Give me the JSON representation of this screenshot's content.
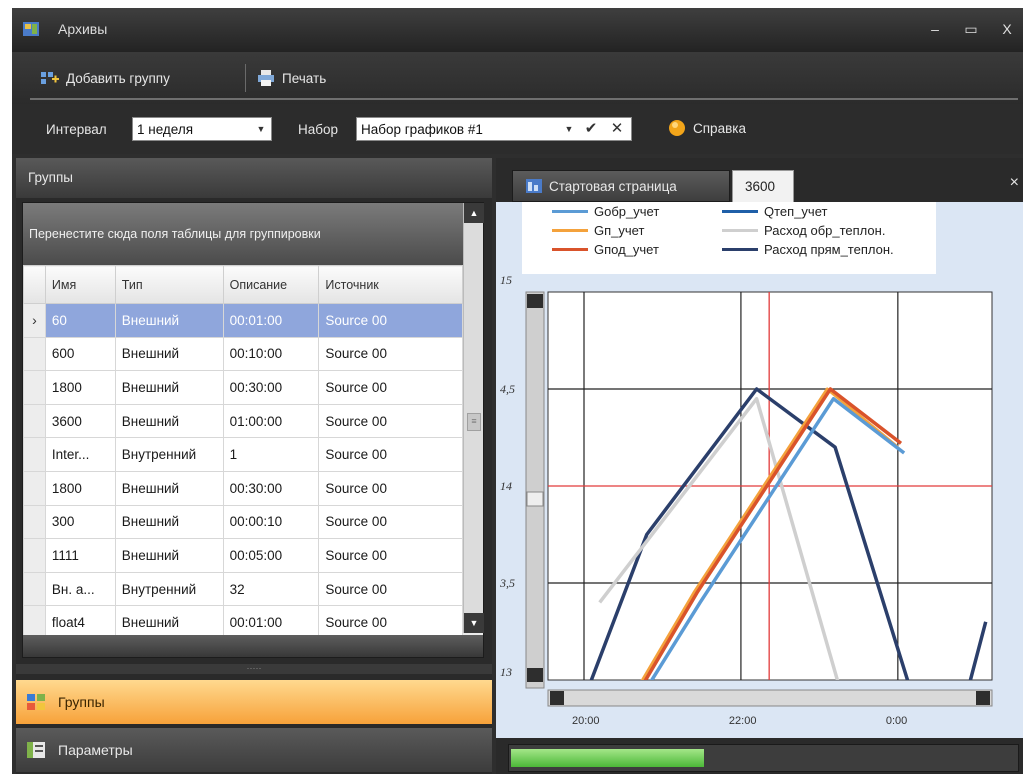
{
  "window": {
    "title": "Архивы",
    "minimize": "–",
    "maximize": "▭",
    "close": "X"
  },
  "toolbar": {
    "add_group": "Добавить группу",
    "print": "Печать"
  },
  "filter": {
    "interval_label": "Интервал",
    "interval_value": "1 неделя",
    "set_label": "Набор",
    "set_value": "Набор графиков #1",
    "confirm": "✔",
    "clear": "✕",
    "help": "Справка"
  },
  "groups_panel": {
    "header": "Группы",
    "group_hint": "Перенестите сюда поля таблицы для группировки",
    "columns": [
      "Имя",
      "Тип",
      "Описание",
      "Источник"
    ],
    "rows": [
      {
        "name": "60",
        "type": "Внешний",
        "desc": "00:01:00",
        "src": "Source 00",
        "selected": true
      },
      {
        "name": "600",
        "type": "Внешний",
        "desc": "00:10:00",
        "src": "Source 00"
      },
      {
        "name": "1800",
        "type": "Внешний",
        "desc": "00:30:00",
        "src": "Source 00"
      },
      {
        "name": "3600",
        "type": "Внешний",
        "desc": "01:00:00",
        "src": "Source 00"
      },
      {
        "name": "Inter...",
        "type": "Внутренний",
        "desc": "1",
        "src": "Source 00"
      },
      {
        "name": "1800",
        "type": "Внешний",
        "desc": "00:30:00",
        "src": "Source 00"
      },
      {
        "name": "300",
        "type": "Внешний",
        "desc": "00:00:10",
        "src": "Source 00"
      },
      {
        "name": "1111",
        "type": "Внешний",
        "desc": "00:05:00",
        "src": "Source 00"
      },
      {
        "name": "Вн. а...",
        "type": "Внутренний",
        "desc": "32",
        "src": "Source 00"
      },
      {
        "name": "float4",
        "type": "Внешний",
        "desc": "00:01:00",
        "src": "Source 00"
      }
    ],
    "row_indicator": "›",
    "splitter": "·····"
  },
  "nav": {
    "groups": "Группы",
    "params": "Параметры"
  },
  "tabs": {
    "start": "Стартовая страница",
    "current": "3600",
    "close": "×"
  },
  "colors": {
    "gobr": "#5b9bd5",
    "gn": "#f4a23c",
    "gpod": "#d9532b",
    "qtep": "#1f5fa8",
    "rashod_obr": "#cfcfcf",
    "rashod_pr": "#2b3f6b"
  },
  "chart_data": {
    "type": "line",
    "legend": [
      {
        "name": "Gобр_учет",
        "color": "#5b9bd5"
      },
      {
        "name": "Qтеп_учет",
        "color": "#1f5fa8"
      },
      {
        "name": "Gп_учет",
        "color": "#f4a23c"
      },
      {
        "name": "Расход обр_теплон.",
        "color": "#cfcfcf"
      },
      {
        "name": "Gпод_учет",
        "color": "#d9532b"
      },
      {
        "name": "Расход прям_теплон.",
        "color": "#2b3f6b"
      }
    ],
    "y_ticks": [
      "15",
      "4,5",
      "14",
      "3,5",
      "13"
    ],
    "x_ticks": [
      "20:00",
      "22:00",
      "0:00"
    ],
    "ylim": [
      13,
      15
    ],
    "series": [
      {
        "name": "Расход прям_теплон.",
        "x": [
          -1.0,
          -0.6,
          0.1,
          0.6,
          1.1,
          1.43,
          1.56
        ],
        "y": [
          12.9,
          13.75,
          14.5,
          14.2,
          12.9,
          12.9,
          13.3
        ]
      },
      {
        "name": "Расход обр_теплон.",
        "x": [
          -0.9,
          0.1,
          0.65
        ],
        "y": [
          13.4,
          14.45,
          12.9
        ]
      },
      {
        "name": "Gп_учет",
        "x": [
          -0.7,
          -0.3,
          0.55,
          1.0
        ],
        "y": [
          12.9,
          13.45,
          14.5,
          14.2
        ]
      },
      {
        "name": "Gпод_учет",
        "x": [
          -0.68,
          -0.28,
          0.57,
          1.02
        ],
        "y": [
          12.9,
          13.45,
          14.5,
          14.22
        ]
      },
      {
        "name": "Gобр_учет",
        "x": [
          -0.66,
          -0.26,
          0.59,
          1.04
        ],
        "y": [
          12.88,
          13.4,
          14.45,
          14.17
        ]
      }
    ],
    "v_red": 0.18,
    "h_red": 14
  },
  "progress": {
    "value": 0.38
  }
}
